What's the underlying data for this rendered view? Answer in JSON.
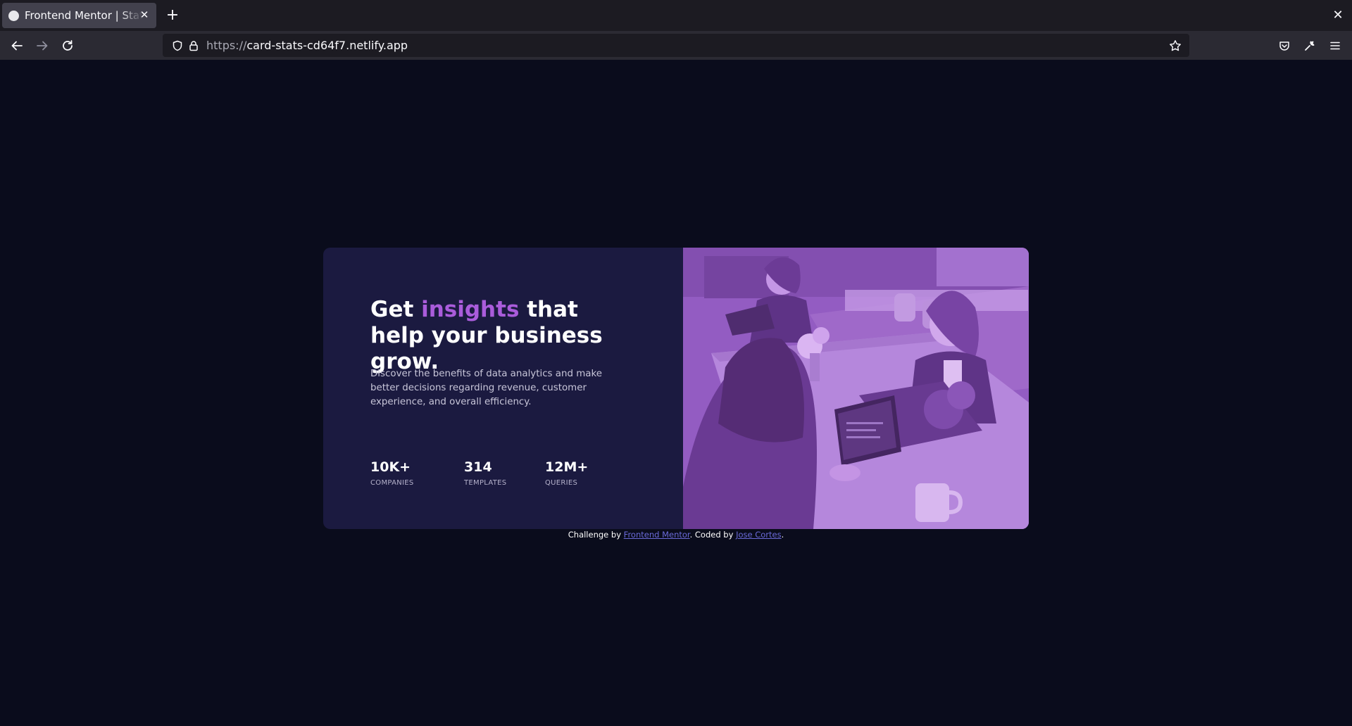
{
  "browser": {
    "tab": {
      "title": "Frontend Mentor | Stats preview card component"
    },
    "url": {
      "scheme": "https://",
      "host": "card-stats-cd64f7.netlify.app"
    }
  },
  "card": {
    "headline": {
      "before": "Get ",
      "accent": "insights",
      "after": " that help your business grow."
    },
    "description": "Discover the benefits of data analytics and make better decisions regarding revenue, customer experience, and overall efficiency.",
    "stats": [
      {
        "value": "10K+",
        "label": "COMPANIES"
      },
      {
        "value": "314",
        "label": "TEMPLATES"
      },
      {
        "value": "12M+",
        "label": "QUERIES"
      }
    ],
    "image": {
      "subject": "people working at a shared office table with laptops, purple tinted"
    }
  },
  "footer": {
    "prefix": "Challenge by ",
    "challenge_link": "Frontend Mentor",
    "middle": ". Coded by ",
    "author_link": "Jose Cortes",
    "suffix": "."
  },
  "colors": {
    "page_background": "#0a0c1c",
    "card_background": "#1b1a40",
    "accent": "#aa5cdb",
    "image_tint": "#8b58b8",
    "link": "#6a6ad8"
  }
}
